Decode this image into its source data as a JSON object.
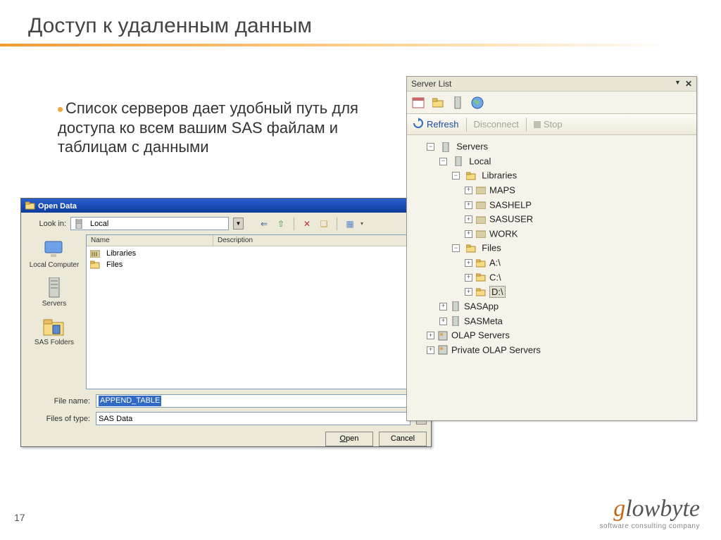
{
  "slide": {
    "title": "Доступ к удаленным данным",
    "bullet": "Список серверов дает удобный путь для доступа ко всем вашим SAS файлам и таблицам с данными",
    "page_number": "17",
    "logo": {
      "brand_g": "g",
      "brand_rest": "lowbyte",
      "tagline": "software consulting company"
    }
  },
  "open_dialog": {
    "title": "Open Data",
    "look_in_label": "Look in:",
    "look_in_value": "Local",
    "columns": {
      "name": "Name",
      "description": "Description"
    },
    "items": [
      "Libraries",
      "Files"
    ],
    "places": [
      "Local Computer",
      "Servers",
      "SAS Folders"
    ],
    "file_name_label": "File name:",
    "file_name_value": "APPEND_TABLE",
    "files_of_type_label": "Files of type:",
    "files_of_type_value": "SAS Data",
    "open_btn": "Open",
    "cancel_btn": "Cancel"
  },
  "server_panel": {
    "title": "Server List",
    "actions": {
      "refresh": "Refresh",
      "disconnect": "Disconnect",
      "stop": "Stop"
    },
    "tree": {
      "root": "Servers",
      "local": "Local",
      "libraries": "Libraries",
      "libs": [
        "MAPS",
        "SASHELP",
        "SASUSER",
        "WORK"
      ],
      "files": "Files",
      "drives": [
        "A:\\",
        "C:\\",
        "D:\\"
      ],
      "sasapp": "SASApp",
      "sasmeta": "SASMeta",
      "olap": "OLAP Servers",
      "private_olap": "Private OLAP Servers"
    }
  }
}
